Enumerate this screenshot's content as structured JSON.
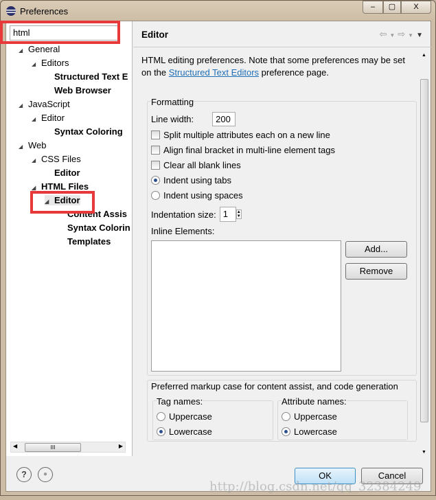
{
  "window": {
    "title": "Preferences",
    "minimize": "–",
    "maximize": "▢",
    "close": "X"
  },
  "search": {
    "value": "html"
  },
  "tree": [
    {
      "label": "General",
      "expanded": true,
      "bold": false
    },
    {
      "label": "Editors",
      "expanded": true,
      "bold": false
    },
    {
      "label": "Structured Text E",
      "bold": true
    },
    {
      "label": "Web Browser",
      "bold": true
    },
    {
      "label": "JavaScript",
      "expanded": true,
      "bold": false
    },
    {
      "label": "Editor",
      "expanded": true,
      "bold": false
    },
    {
      "label": "Syntax Coloring",
      "bold": true
    },
    {
      "label": "Web",
      "expanded": true,
      "bold": false
    },
    {
      "label": "CSS Files",
      "expanded": true,
      "bold": false
    },
    {
      "label": "Editor",
      "bold": true
    },
    {
      "label": "HTML Files",
      "expanded": true,
      "bold": true
    },
    {
      "label": "Editor",
      "expanded": true,
      "bold": true,
      "selected": true
    },
    {
      "label": "Content Assis",
      "bold": true
    },
    {
      "label": "Syntax Colorin",
      "bold": true
    },
    {
      "label": "Templates",
      "bold": true
    }
  ],
  "hscroll_label": "III",
  "page": {
    "title": "Editor",
    "desc_before": "HTML editing preferences.  Note that some preferences may be set on the ",
    "desc_link": "Structured Text Editors",
    "desc_after": " preference page.",
    "formatting": {
      "label": "Formatting",
      "line_width_label": "Line width:",
      "line_width": "200",
      "options": [
        {
          "label": "Split multiple attributes each on a new line",
          "type": "checkbox",
          "checked": false
        },
        {
          "label": "Align final bracket in multi-line element tags",
          "type": "checkbox",
          "checked": false
        },
        {
          "label": "Clear all blank lines",
          "type": "checkbox",
          "checked": false
        },
        {
          "label": "Indent using tabs",
          "type": "radio",
          "checked": true
        },
        {
          "label": "Indent using spaces",
          "type": "radio",
          "checked": false
        }
      ],
      "indent_label": "Indentation size:",
      "indent": "1",
      "inline_label": "Inline Elements:",
      "add": "Add...",
      "remove": "Remove"
    },
    "markup": {
      "label": "Preferred markup case for content assist, and code generation",
      "tag_label": "Tag names:",
      "attr_label": "Attribute names:",
      "upper": "Uppercase",
      "lower": "Lowercase",
      "tag_value": "Lowercase",
      "attr_value": "Lowercase"
    }
  },
  "footer": {
    "help": "?",
    "ok": "OK",
    "cancel": "Cancel"
  },
  "watermark": "http://blog.csdn.net/qq_32384249",
  "colors": {
    "highlight_box": "#e8393a",
    "link": "#1f6fb7"
  }
}
